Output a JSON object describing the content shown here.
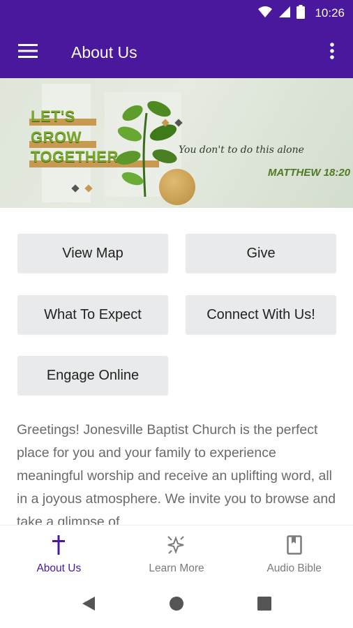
{
  "status_bar": {
    "time": "10:26",
    "icons": [
      "wifi-icon",
      "signal-icon",
      "battery-icon"
    ]
  },
  "app_bar": {
    "title": "About Us",
    "menu_icon": "menu-icon",
    "overflow_icon": "more-vert-icon",
    "color": "#4a189d"
  },
  "banner": {
    "headline": [
      "LET'S",
      "GROW",
      "TOGETHER"
    ],
    "script_text": "You don't to do this alone",
    "verse": "MATTHEW 18:20"
  },
  "buttons": {
    "view_map": "View Map",
    "give": "Give",
    "what_to_expect": "What To Expect",
    "connect": "Connect With Us!",
    "engage_online": "Engage Online"
  },
  "description": "Greetings! Jonesville Baptist Church is the perfect place for you and your family to experience meaningful worship and receive an uplifting word, all in a joyous atmosphere. We invite you to browse and take a glimpse of",
  "bottom_nav": {
    "items": [
      {
        "label": "About Us",
        "icon": "cross-icon",
        "active": true
      },
      {
        "label": "Learn More",
        "icon": "sparkle-icon",
        "active": false
      },
      {
        "label": "Audio Bible",
        "icon": "book-icon",
        "active": false
      }
    ],
    "active_color": "#4a189d"
  },
  "system_nav": {
    "icons": [
      "back-icon",
      "home-icon",
      "recents-icon"
    ]
  }
}
